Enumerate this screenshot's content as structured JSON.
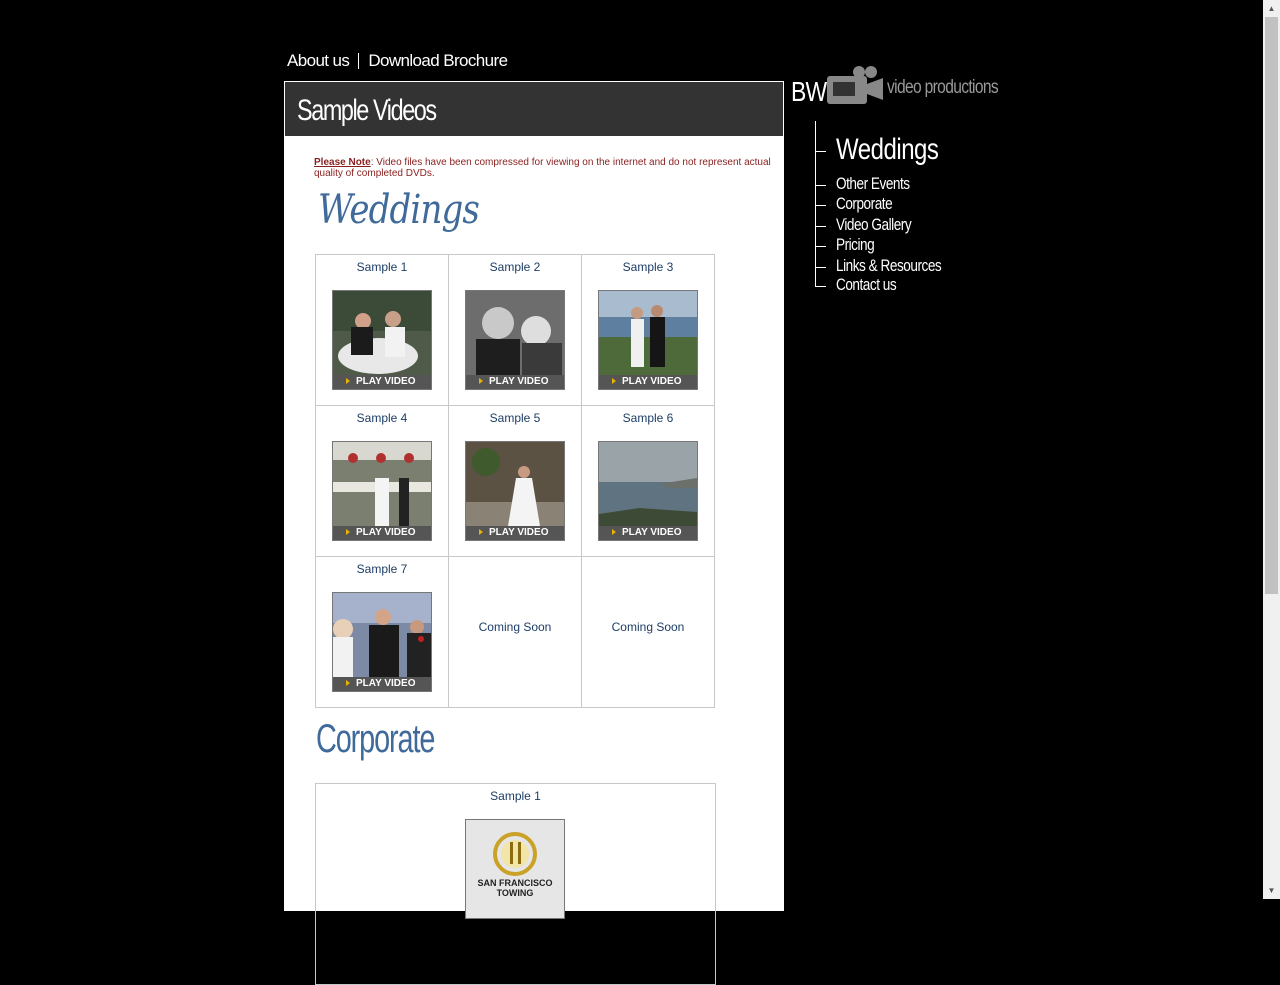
{
  "topnav": {
    "about": "About us",
    "brochure": "Download Brochure"
  },
  "panel": {
    "title": "Sample Videos",
    "note_label": "Please Note",
    "note_text": ": Video files have been compressed for viewing on the internet and do not represent actual quality of completed DVDs."
  },
  "weddings": {
    "heading": "Weddings",
    "play_label": "PLAY VIDEO",
    "coming_label": "Coming Soon",
    "samples": [
      "Sample 1",
      "Sample 2",
      "Sample 3",
      "Sample 4",
      "Sample 5",
      "Sample 6",
      "Sample 7"
    ]
  },
  "corporate": {
    "heading": "Corporate",
    "samples": [
      "Sample 1"
    ],
    "thumb_logo_text": "SAN FRANCISCO TOWING"
  },
  "logo": {
    "bw": "BW",
    "text": "video productions"
  },
  "sidebar": {
    "items": [
      {
        "label": "Weddings"
      },
      {
        "label": "Other Events"
      },
      {
        "label": "Corporate"
      },
      {
        "label": "Video Gallery"
      },
      {
        "label": "Pricing"
      },
      {
        "label": "Links & Resources"
      },
      {
        "label": "Contact us"
      }
    ]
  },
  "colors": {
    "accent": "#3f6a9a",
    "note": "#8a1f1f",
    "header": "#333333",
    "play_arrow": "#e8b400"
  }
}
